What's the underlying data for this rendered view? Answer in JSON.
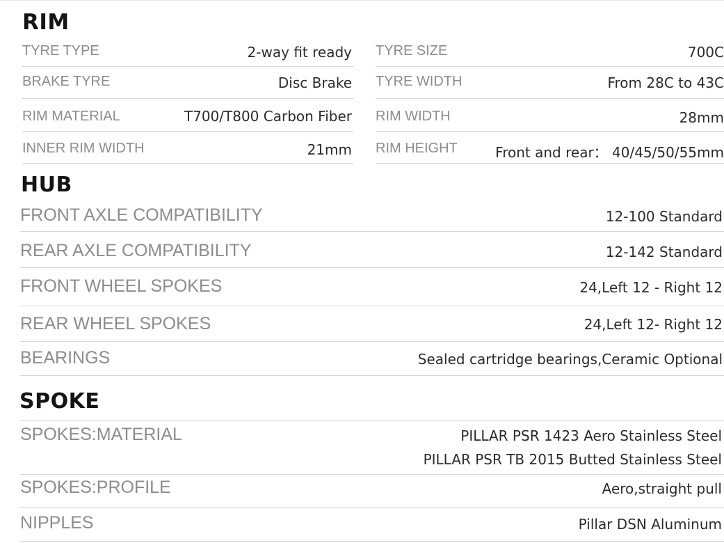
{
  "rim": {
    "title": "RIM",
    "rows": [
      {
        "label_a": "TYRE TYPE",
        "value_a": "2-way fit ready",
        "label_b": "TYRE SIZE",
        "value_b": "700C"
      },
      {
        "label_a": "BRAKE TYRE",
        "value_a": "Disc Brake",
        "label_b": "TYRE WIDTH",
        "value_b": "From 28C to 43C"
      },
      {
        "label_a": "RIM MATERIAL",
        "value_a": "T700/T800 Carbon Fiber",
        "label_b": "RIM WIDTH",
        "value_b": "28mm"
      },
      {
        "label_a": "INNER RIM WIDTH",
        "value_a": "21mm",
        "label_b": "RIM HEIGHT",
        "value_b": "Front and rear： 40/45/50/55mm"
      }
    ]
  },
  "hub": {
    "title": "HUB",
    "rows": [
      {
        "label": "FRONT  AXLE COMPATIBILITY",
        "value": "12-100 Standard"
      },
      {
        "label": "REAR AXLE COMPATIBILITY",
        "value": "12-142 Standard"
      },
      {
        "label": "FRONT WHEEL SPOKES",
        "value": "24,Left 12 - Right 12"
      },
      {
        "label": "REAR WHEEL SPOKES",
        "value": "24,Left 12- Right 12"
      },
      {
        "label": "BEARINGS",
        "value": "Sealed cartridge bearings,Ceramic Optional"
      }
    ]
  },
  "spoke": {
    "title": "SPOKE",
    "rows": [
      {
        "label": "SPOKES:MATERIAL",
        "value": "PILLAR PSR 1423 Aero Stainless Steel",
        "value2": "PILLAR PSR TB 2015 Butted Stainless Steel"
      },
      {
        "label": "SPOKES:PROFILE",
        "value": "Aero,straight pull"
      },
      {
        "label": "NIPPLES",
        "value": "Pillar DSN Aluminum"
      }
    ]
  }
}
